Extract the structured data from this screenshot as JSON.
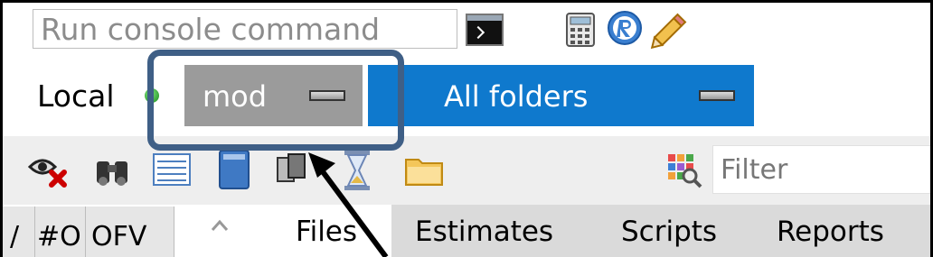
{
  "command": {
    "placeholder": "Run console command"
  },
  "location": {
    "label": "Local"
  },
  "model_select": {
    "value": "mod"
  },
  "folder_select": {
    "value": "All folders"
  },
  "filter": {
    "placeholder": "Filter"
  },
  "columns": [
    "/",
    "#O",
    "OFV"
  ],
  "tabs": [
    "Files",
    "Estimates",
    "Scripts",
    "Reports"
  ],
  "active_tab": "Files",
  "colors": {
    "folder_select_bg": "#0f79cd",
    "model_select_bg": "#9b9b9b",
    "highlight": "#3f5f86",
    "status_dot": "#2eaa2e"
  },
  "icons": [
    "console-icon",
    "calculator-icon",
    "r-icon",
    "pencil-icon",
    "hide-icon",
    "binoculars-icon",
    "list-icon",
    "book-icon",
    "copy-icon",
    "hourglass-icon",
    "folder-icon",
    "grid-filter-icon"
  ]
}
